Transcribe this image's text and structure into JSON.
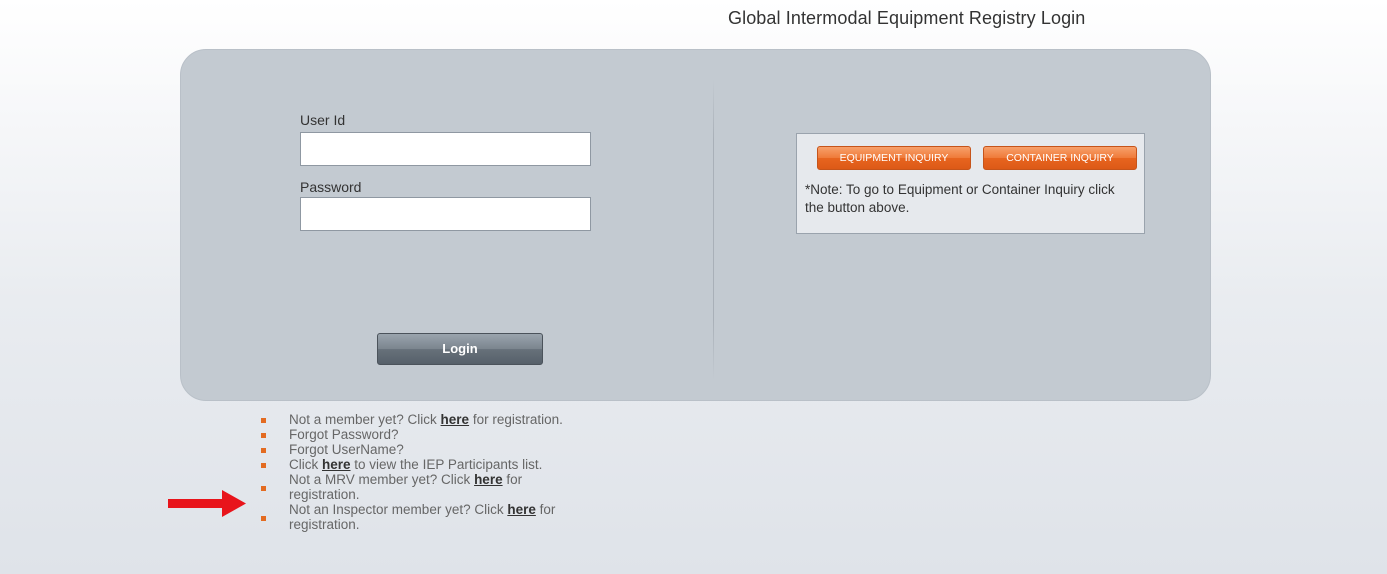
{
  "page_title": "Global Intermodal Equipment Registry Login",
  "login_form": {
    "user_id_label": "User Id",
    "user_id_value": "",
    "password_label": "Password",
    "password_value": "",
    "login_button": "Login"
  },
  "inquiry": {
    "equipment_button": "EQUIPMENT INQUIRY",
    "container_button": "CONTAINER INQUIRY",
    "note": "*Note: To go to Equipment or Container Inquiry click the button above."
  },
  "links": [
    {
      "before": "Not a member yet? Click ",
      "link": "here",
      "after": " for registration."
    },
    {
      "before": "Forgot Password?",
      "link": "",
      "after": ""
    },
    {
      "before": "Forgot UserName?",
      "link": "",
      "after": ""
    },
    {
      "before": "Click ",
      "link": "here",
      "after": " to view the IEP Participants list."
    },
    {
      "before": "Not a MRV member yet? Click ",
      "link": "here",
      "after": " for",
      "line2": "registration."
    },
    {
      "before": "Not an Inspector member yet? Click ",
      "link": "here",
      "after": " for",
      "line2": "registration."
    }
  ],
  "colors": {
    "panel": "#c3cad1",
    "accent_orange": "#e36b21",
    "arrow_red": "#e8141b"
  },
  "icons": {
    "annotation_arrow": "red-right-arrow"
  }
}
